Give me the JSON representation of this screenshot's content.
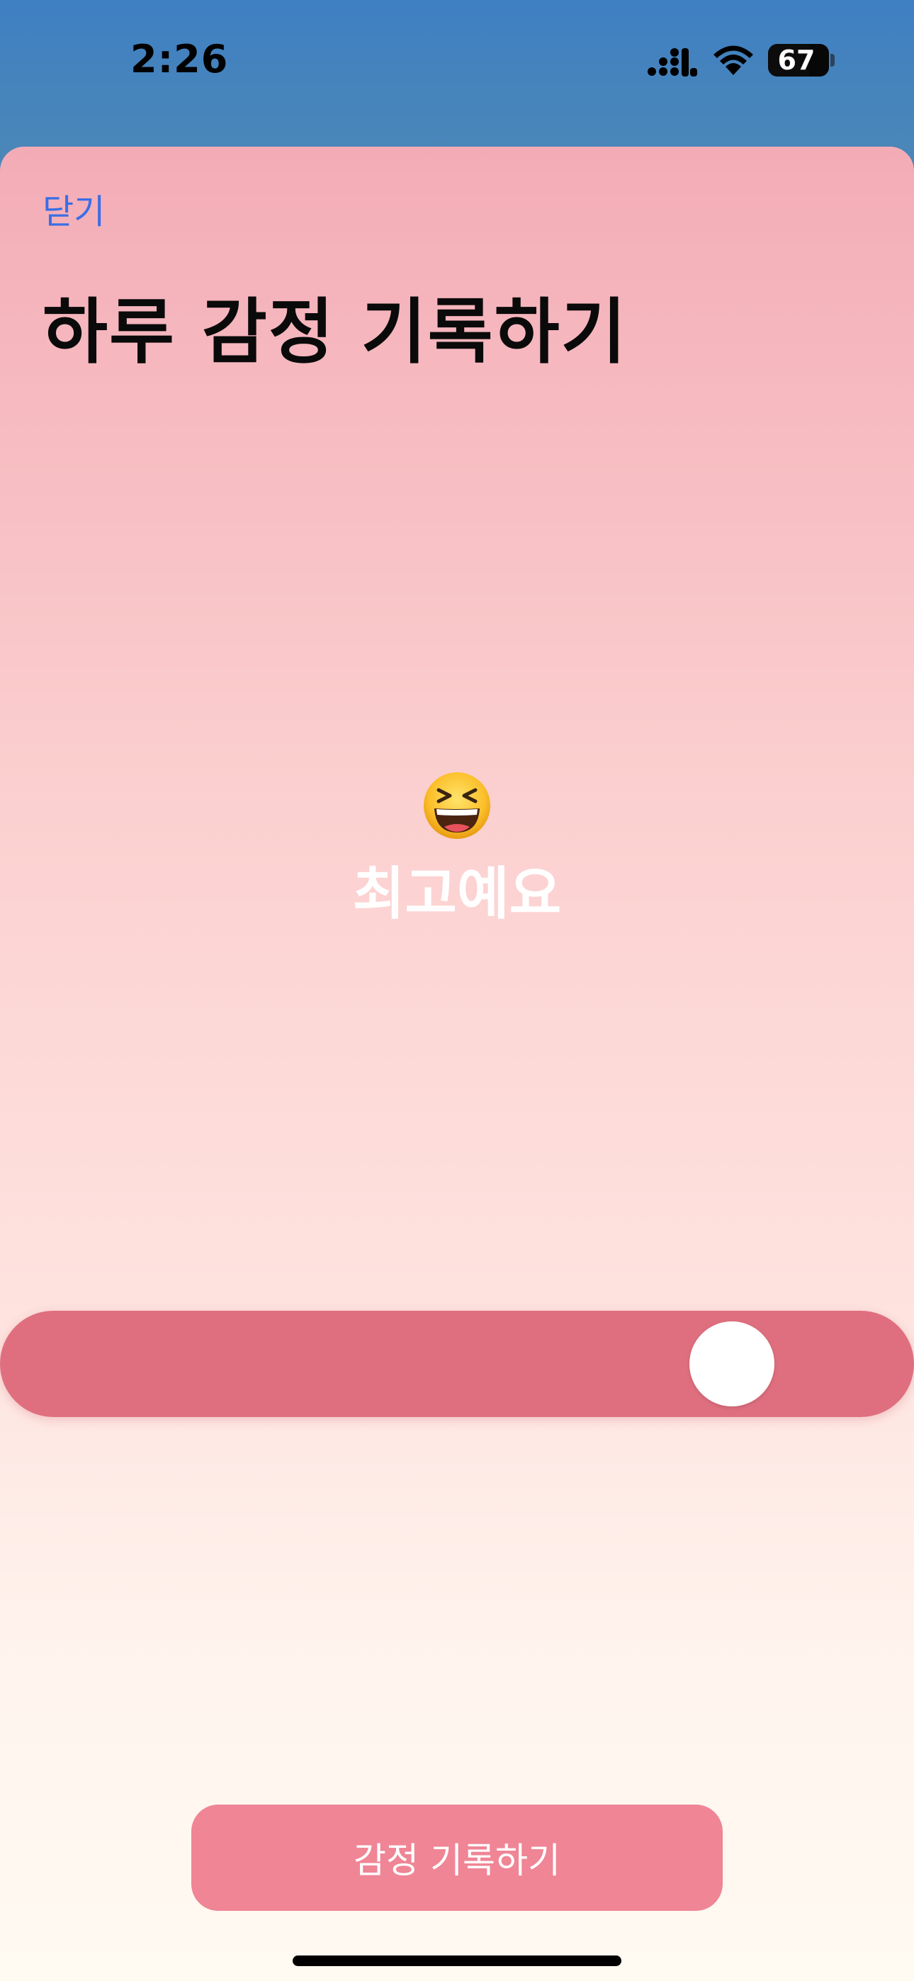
{
  "status_bar": {
    "time": "2:26",
    "battery_level": "67",
    "battery_fraction": 0.67,
    "icons": [
      "cellular-signal-icon",
      "wifi-icon",
      "battery-icon"
    ]
  },
  "sheet": {
    "close_label": "닫기",
    "title": "하루 감정 기록하기",
    "mood": {
      "emoji_name": "grinning-squinting-face-icon",
      "label": "최고예요"
    },
    "mood_slider": {
      "value_fraction": 0.84
    },
    "submit_label": "감정 기록하기"
  },
  "colors": {
    "status_bar_bg": "#3f80c3",
    "link": "#3a6ee6",
    "slider_track": "#df6f7f",
    "button_bg": "#ef8595",
    "sheet_top": "#f3acb6",
    "sheet_bottom": "#fffaf2"
  }
}
